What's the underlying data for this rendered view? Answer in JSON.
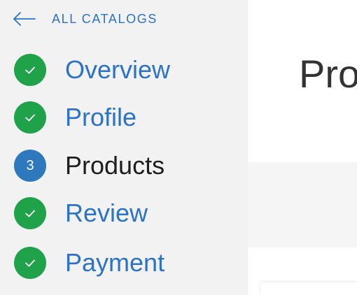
{
  "colors": {
    "accent_blue": "#2a73c6",
    "done_green": "#1fa24a",
    "current_blue": "#2e78bd",
    "sidebar_bg": "#f2f2f2",
    "panel_bg": "#f5f5f5"
  },
  "sidebar": {
    "back": {
      "icon": "arrow-left-icon",
      "label": "ALL CATALOGS"
    },
    "steps": [
      {
        "label": "Overview",
        "state": "done",
        "icon": "check-icon"
      },
      {
        "label": "Profile",
        "state": "done",
        "icon": "check-icon"
      },
      {
        "label": "Products",
        "state": "current",
        "number": "3"
      },
      {
        "label": "Review",
        "state": "done",
        "icon": "check-icon"
      },
      {
        "label": "Payment",
        "state": "done",
        "icon": "check-icon"
      }
    ]
  },
  "main": {
    "title": "Products"
  }
}
